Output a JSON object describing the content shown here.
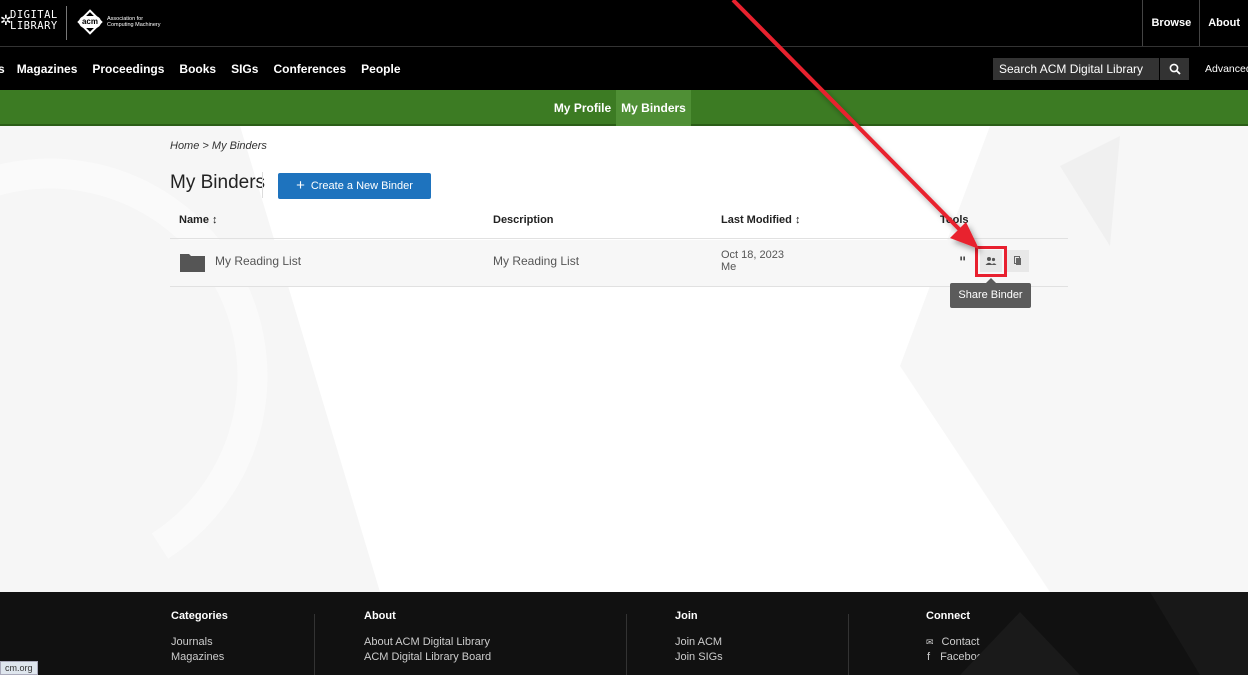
{
  "header": {
    "logo_line1": "DIGITAL",
    "logo_line2": "LIBRARY",
    "acm_short": "acm",
    "acm_line1": "Association for",
    "acm_line2": "Computing Machinery",
    "top_links": [
      "Browse",
      "About"
    ]
  },
  "nav": {
    "items": [
      "s",
      "Magazines",
      "Proceedings",
      "Books",
      "SIGs",
      "Conferences",
      "People"
    ],
    "search_placeholder": "Search ACM Digital Library",
    "advanced": "Advanced S"
  },
  "subnav": {
    "profile": "My Profile",
    "binders": "My Binders"
  },
  "breadcrumb": {
    "home": "Home",
    "sep": ">",
    "current": "My Binders"
  },
  "page": {
    "title": "My Binders",
    "create_label": "Create a New Binder"
  },
  "table": {
    "headers": {
      "name": "Name ↕",
      "description": "Description",
      "modified": "Last Modified ↕",
      "tools": "Tools"
    },
    "rows": [
      {
        "name": "My Reading List",
        "description": "My Reading List",
        "date": "Oct 18, 2023",
        "by": "Me"
      }
    ],
    "tooltip": "Share Binder"
  },
  "footer": {
    "categories": {
      "title": "Categories",
      "links": [
        "Journals",
        "Magazines"
      ]
    },
    "about": {
      "title": "About",
      "links": [
        "About ACM Digital Library",
        "ACM Digital Library Board"
      ]
    },
    "join": {
      "title": "Join",
      "links": [
        "Join ACM",
        "Join SIGs"
      ]
    },
    "connect": {
      "title": "Connect",
      "links": [
        "Contact",
        "Facebook"
      ]
    }
  },
  "status_url": "cm.org",
  "colors": {
    "green": "#3c7b23",
    "blue": "#1e73be",
    "annotation_red": "#e8202f"
  }
}
